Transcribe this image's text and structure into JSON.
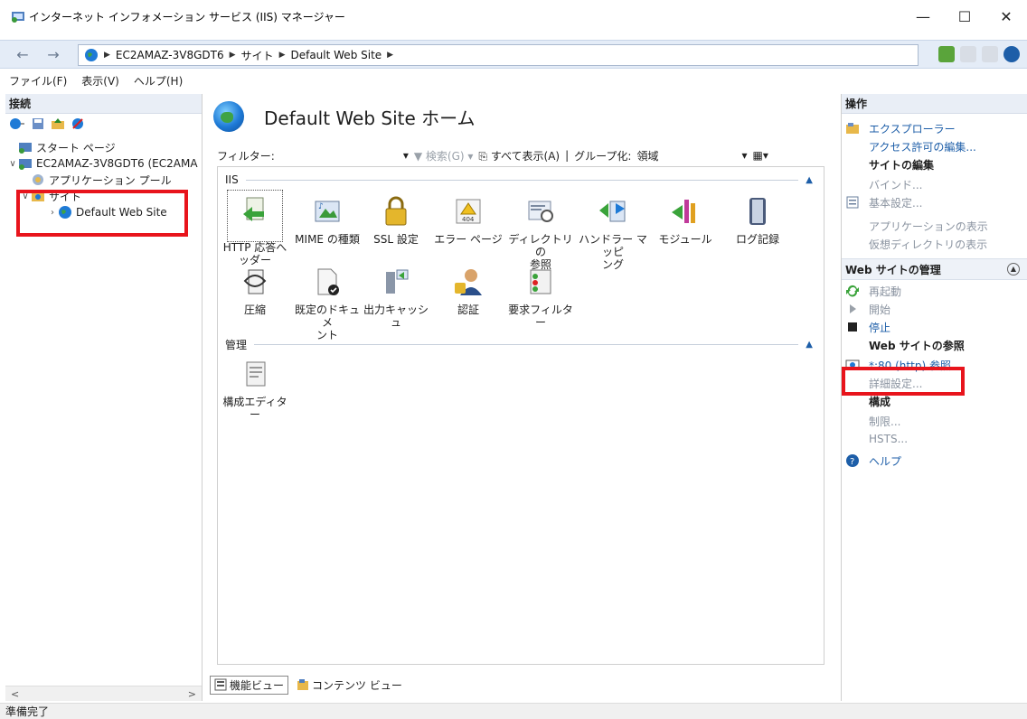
{
  "window": {
    "title": "インターネット インフォメーション サービス (IIS) マネージャー",
    "controls": [
      "—",
      "☐",
      "✕"
    ]
  },
  "address": {
    "crumbs": [
      "EC2AMAZ-3V8GDT6",
      "サイト",
      "Default Web Site"
    ]
  },
  "menu": [
    "ファイル(F)",
    "表示(V)",
    "ヘルプ(H)"
  ],
  "connections": {
    "header": "接続",
    "tree": [
      {
        "label": "スタート ページ",
        "indent": 0
      },
      {
        "label": "EC2AMAZ-3V8GDT6 (EC2AMA",
        "indent": 0
      },
      {
        "label": "アプリケーション プール",
        "indent": 1
      },
      {
        "label": "サイト",
        "indent": 1
      },
      {
        "label": "Default Web Site",
        "indent": 2
      }
    ]
  },
  "main": {
    "title": "Default Web Site ホーム",
    "filter_label": "フィルター:",
    "search_label": "検索(G)",
    "show_all_label": "すべて表示(A)",
    "group_by_label": "グループ化:",
    "group_by_value": "領域",
    "groups": [
      {
        "name": "IIS",
        "features": [
          {
            "line1": "HTTP 応答へ",
            "line2": "ッダー",
            "icon": "http-response-headers-icon"
          },
          {
            "line1": "MIME の種類",
            "line2": "",
            "icon": "mime-types-icon"
          },
          {
            "line1": "SSL 設定",
            "line2": "",
            "icon": "ssl-lock-icon"
          },
          {
            "line1": "エラー ページ",
            "line2": "",
            "icon": "error-404-icon"
          },
          {
            "line1": "ディレクトリの",
            "line2": "参照",
            "icon": "directory-browsing-icon"
          },
          {
            "line1": "ハンドラー マッピ",
            "line2": "ング",
            "icon": "handler-mappings-icon"
          },
          {
            "line1": "モジュール",
            "line2": "",
            "icon": "modules-icon"
          },
          {
            "line1": "ログ記録",
            "line2": "",
            "icon": "logging-icon"
          },
          {
            "line1": "圧縮",
            "line2": "",
            "icon": "compression-icon"
          },
          {
            "line1": "既定のドキュメ",
            "line2": "ント",
            "icon": "default-document-icon"
          },
          {
            "line1": "出力キャッシュ",
            "line2": "",
            "icon": "output-cache-icon"
          },
          {
            "line1": "認証",
            "line2": "",
            "icon": "authentication-icon"
          },
          {
            "line1": "要求フィルター",
            "line2": "",
            "icon": "request-filtering-icon"
          }
        ]
      },
      {
        "name": "管理",
        "features": [
          {
            "line1": "構成エディター",
            "line2": "",
            "icon": "configuration-editor-icon"
          }
        ]
      }
    ],
    "view_tabs": [
      "機能ビュー",
      "コンテンツ ビュー"
    ]
  },
  "actions": {
    "header": "操作",
    "explore": "エクスプローラー",
    "edit_permissions": "アクセス許可の編集...",
    "edit_site_head": "サイトの編集",
    "bindings": "バインド...",
    "basic_settings": "基本設定...",
    "view_applications": "アプリケーションの表示",
    "view_virtual_dirs": "仮想ディレクトリの表示",
    "manage_section": "Web サイトの管理",
    "restart": "再起動",
    "start": "開始",
    "stop": "停止",
    "browse_head": "Web サイトの参照",
    "browse_80": "*:80 (http) 参照",
    "advanced_settings": "詳細設定...",
    "config_head": "構成",
    "limits": "制限...",
    "hsts": "HSTS...",
    "help": "ヘルプ"
  },
  "status": {
    "text": "準備完了"
  },
  "colors": {
    "highlight": "#e8141c",
    "link": "#1d5ea8",
    "panel_header": "#e9eef6"
  }
}
